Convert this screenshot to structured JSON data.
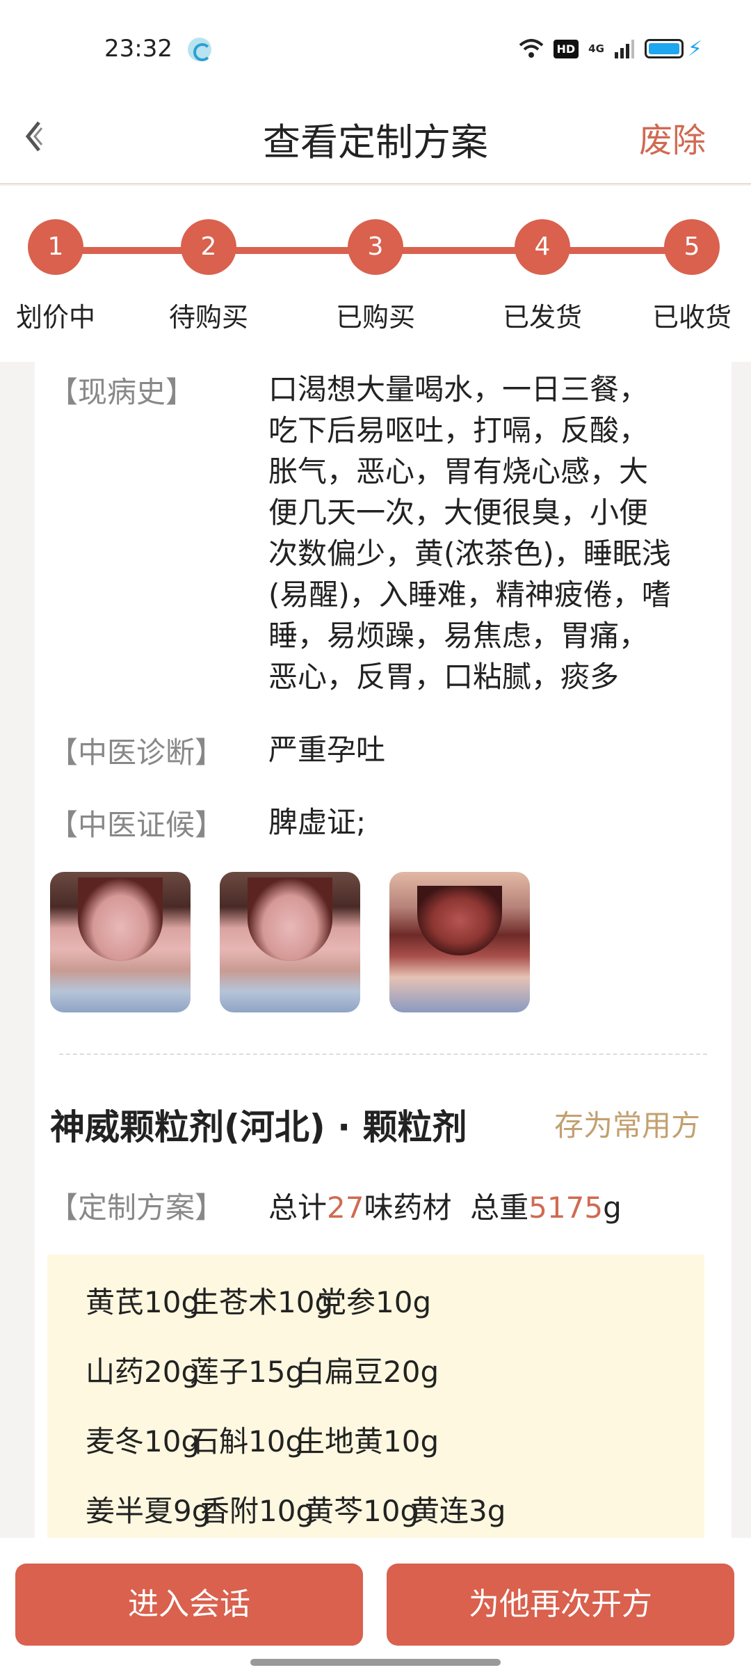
{
  "status_bar": {
    "time": "23:32",
    "hd": "HD",
    "signal": "4G"
  },
  "nav": {
    "title": "查看定制方案",
    "action": "废除"
  },
  "steps": [
    {
      "num": "1",
      "label": "划价中"
    },
    {
      "num": "2",
      "label": "待购买"
    },
    {
      "num": "3",
      "label": "已购买"
    },
    {
      "num": "4",
      "label": "已发货"
    },
    {
      "num": "5",
      "label": "已收货"
    }
  ],
  "history": {
    "label": "【现病史】",
    "lines": [
      "口渴想大量喝水，一日三餐，",
      "吃下后易呕吐，打嗝，反酸，",
      "胀气，恶心，胃有烧心感，大",
      "便几天一次，大便很臭，小便",
      "次数偏少，黄(浓茶色)，睡眠浅",
      "(易醒)，入睡难，精神疲倦，嗜",
      "睡，易烦躁，易焦虑，胃痛，",
      "恶心，反胃，口粘腻，痰多"
    ]
  },
  "diagnosis": {
    "label": "【中医诊断】",
    "value": "严重孕吐"
  },
  "syndrome": {
    "label": "【中医证候】",
    "value": "脾虚证;"
  },
  "drug": {
    "title": "神威颗粒剂(河北) · 颗粒剂",
    "save_label": "存为常用方"
  },
  "plan": {
    "label": "【定制方案】",
    "prefix": "总计",
    "count": "27",
    "mid": "味药材  总重",
    "weight": "5175",
    "unit": "g"
  },
  "herbs": [
    [
      "黄芪10g",
      "生苍术10g",
      "党参10g"
    ],
    [
      "山药20g",
      "莲子15g",
      "白扁豆20g"
    ],
    [
      "麦冬10g",
      "石斛10g",
      "生地黄10g"
    ],
    [
      "姜半夏9g",
      "香附10g",
      "黄芩10g",
      "黄连3g"
    ]
  ],
  "buttons": {
    "chat": "进入会话",
    "represcribe": "为他再次开方"
  },
  "colors": {
    "accent": "#d9614e",
    "highlight": "#d06a52",
    "gold": "#c3a070",
    "herb_bg": "#fef8e0"
  }
}
